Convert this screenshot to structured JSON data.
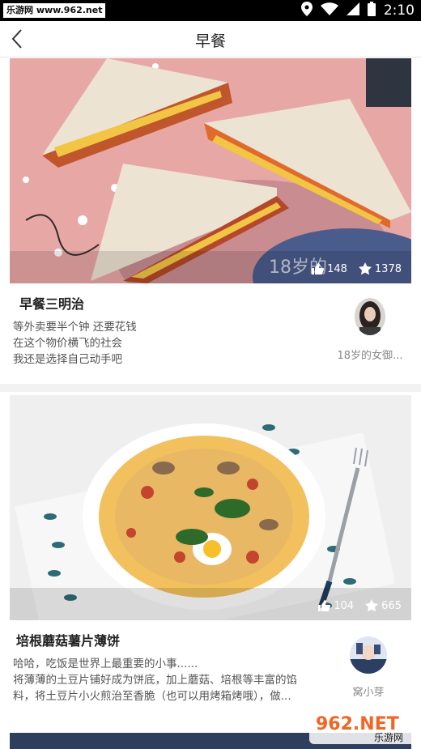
{
  "status_bar": {
    "site_badge": "乐游网 www.962.net",
    "time": "2:10"
  },
  "nav": {
    "title": "早餐"
  },
  "recipes": [
    {
      "title": "早餐三明治",
      "likes": "148",
      "favorites": "1378",
      "description": [
        "等外卖要半个钟 还要花钱",
        "在这个物价横飞的社会",
        "我还是选择自己动手吧"
      ],
      "author": "18岁的女御...",
      "photo_text": "18岁的"
    },
    {
      "title": "培根蘑菇薯片薄饼",
      "likes": "104",
      "favorites": "665",
      "description": [
        "哈哈，吃饭是世界上最重要的小事......",
        "将薄薄的土豆片铺好成为饼底，加上蘑菇、培根等丰富的馅",
        "料，将土豆片小火煎治至香脆（也可以用烤箱烤哦），做..."
      ],
      "author": "窝小芽"
    }
  ],
  "watermark": {
    "text": "962.NET",
    "sub": "乐游网"
  }
}
